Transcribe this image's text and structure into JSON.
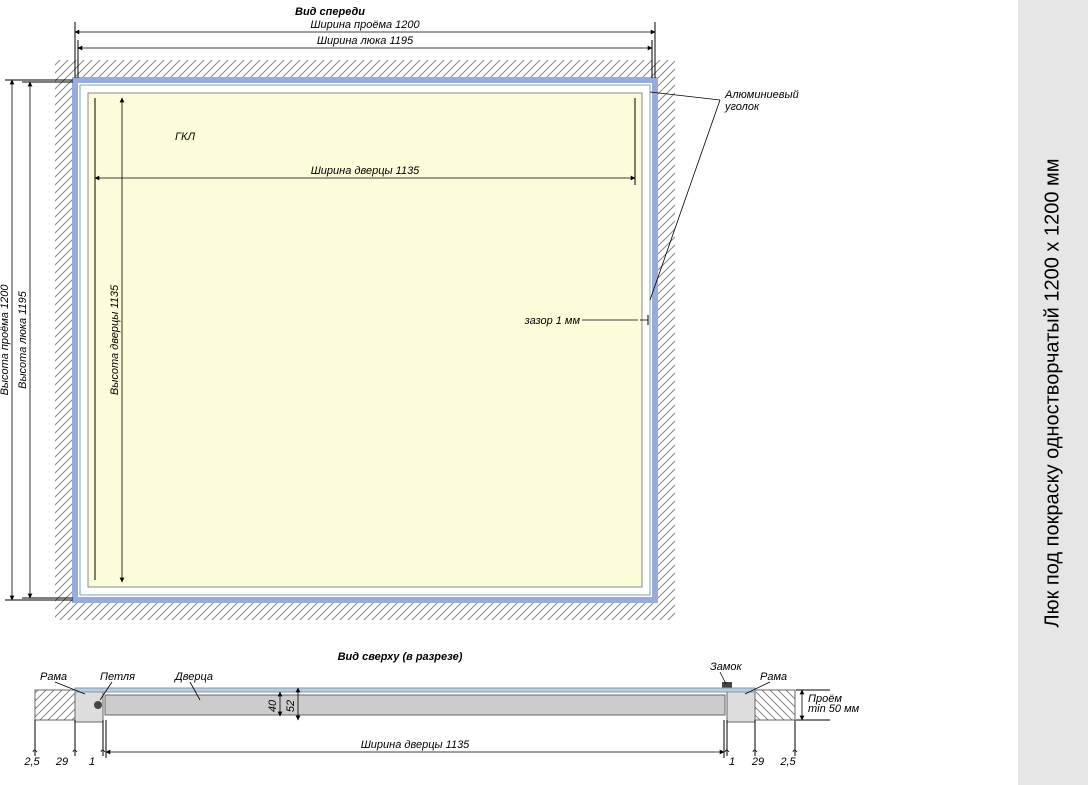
{
  "sidebar_title": "Люк под покраску одностворчатый 1200 х 1200 мм",
  "front": {
    "title": "Вид спереди",
    "opening_width": "Ширина проёма 1200",
    "hatch_width": "Ширина люка 1195",
    "door_width": "Ширина дверцы 1135",
    "opening_height": "Высота проёма 1200",
    "hatch_height": "Высота люка 1195",
    "door_height": "Высота дверцы 1135",
    "gkl": "ГКЛ",
    "corner": "Алюминиевый\nуголок",
    "gap": "зазор 1 мм"
  },
  "top": {
    "title": "Вид сверху (в разрезе)",
    "frame": "Рама",
    "hinge": "Петля",
    "door": "Дверца",
    "lock": "Замок",
    "opening": "Проём\nmin 50 мм",
    "door_width": "Ширина дверцы 1135",
    "d25": "2,5",
    "d29": "29",
    "d1": "1",
    "d40": "40",
    "d52": "52"
  }
}
